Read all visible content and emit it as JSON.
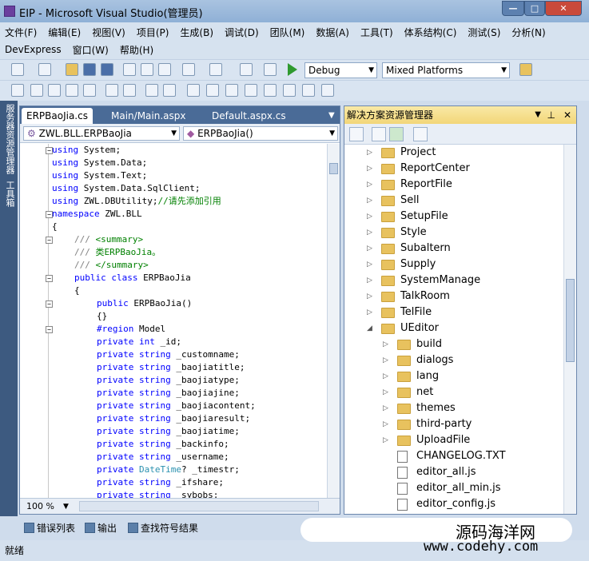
{
  "window": {
    "title": "EIP - Microsoft Visual Studio(管理员)",
    "min": "—",
    "max": "□",
    "close": "✕"
  },
  "menu": {
    "row1": [
      "文件(F)",
      "编辑(E)",
      "视图(V)",
      "项目(P)",
      "生成(B)",
      "调试(D)",
      "团队(M)",
      "数据(A)",
      "工具(T)",
      "体系结构(C)",
      "测试(S)",
      "分析(N)"
    ],
    "row2": [
      "DevExpress",
      "窗口(W)",
      "帮助(H)"
    ]
  },
  "toolbar": {
    "config": "Debug",
    "platform": "Mixed Platforms",
    "start_icon": "play-icon"
  },
  "leftstrip": {
    "server_explorer": "服务器资源管理器",
    "toolbox": "工具箱"
  },
  "editor": {
    "tabs": [
      "ERPBaoJia.cs",
      "Main/Main.aspx",
      "Default.aspx.cs"
    ],
    "nav_type": "ZWL.BLL.ERPBaoJia",
    "nav_member": "ERPBaoJia()",
    "zoom": "100 %",
    "lines": [
      {
        "c": "using System;",
        "i": 0
      },
      {
        "c": "using System.Data;",
        "i": 0
      },
      {
        "c": "using System.Text;",
        "i": 0
      },
      {
        "c": "using System.Data.SqlClient;",
        "i": 0
      },
      {
        "c": "using ZWL.DBUtility;//请先添加引用",
        "i": 0
      },
      {
        "c": "namespace ZWL.BLL",
        "i": 0
      },
      {
        "c": "{",
        "i": 0
      },
      {
        "c": "/// <summary>",
        "i": 4
      },
      {
        "c": "/// 类ERPBaoJia。",
        "i": 4
      },
      {
        "c": "/// </summary>",
        "i": 4
      },
      {
        "c": "public class ERPBaoJia",
        "i": 4
      },
      {
        "c": "{",
        "i": 4
      },
      {
        "c": "public ERPBaoJia()",
        "i": 8
      },
      {
        "c": "{}",
        "i": 8
      },
      {
        "c": "#region Model",
        "i": 8
      },
      {
        "c": "private int _id;",
        "i": 8
      },
      {
        "c": "private string _customname;",
        "i": 8
      },
      {
        "c": "private string _baojiatitle;",
        "i": 8
      },
      {
        "c": "private string _baojiatype;",
        "i": 8
      },
      {
        "c": "private string _baojiajine;",
        "i": 8
      },
      {
        "c": "private string _baojiacontent;",
        "i": 8
      },
      {
        "c": "private string _baojiaresult;",
        "i": 8
      },
      {
        "c": "private string _baojiatime;",
        "i": 8
      },
      {
        "c": "private string _backinfo;",
        "i": 8
      },
      {
        "c": "private string _username;",
        "i": 8
      },
      {
        "c": "private DateTime? _timestr;",
        "i": 8
      },
      {
        "c": "private string _ifshare;",
        "i": 8
      },
      {
        "c": "private string _sybobs;",
        "i": 8
      }
    ]
  },
  "solution": {
    "title": "解决方案资源管理器",
    "items": [
      {
        "label": "Project",
        "d": 0,
        "t": "folder",
        "e": "▷"
      },
      {
        "label": "ReportCenter",
        "d": 0,
        "t": "folder",
        "e": "▷"
      },
      {
        "label": "ReportFile",
        "d": 0,
        "t": "folder",
        "e": "▷"
      },
      {
        "label": "Sell",
        "d": 0,
        "t": "folder",
        "e": "▷"
      },
      {
        "label": "SetupFile",
        "d": 0,
        "t": "folder",
        "e": "▷"
      },
      {
        "label": "Style",
        "d": 0,
        "t": "folder",
        "e": "▷"
      },
      {
        "label": "Subaltern",
        "d": 0,
        "t": "folder",
        "e": "▷"
      },
      {
        "label": "Supply",
        "d": 0,
        "t": "folder",
        "e": "▷"
      },
      {
        "label": "SystemManage",
        "d": 0,
        "t": "folder",
        "e": "▷"
      },
      {
        "label": "TalkRoom",
        "d": 0,
        "t": "folder",
        "e": "▷"
      },
      {
        "label": "TelFile",
        "d": 0,
        "t": "folder",
        "e": "▷"
      },
      {
        "label": "UEditor",
        "d": 0,
        "t": "folder",
        "e": "◢"
      },
      {
        "label": "build",
        "d": 1,
        "t": "folder",
        "e": "▷"
      },
      {
        "label": "dialogs",
        "d": 1,
        "t": "folder",
        "e": "▷"
      },
      {
        "label": "lang",
        "d": 1,
        "t": "folder",
        "e": "▷"
      },
      {
        "label": "net",
        "d": 1,
        "t": "folder",
        "e": "▷"
      },
      {
        "label": "themes",
        "d": 1,
        "t": "folder",
        "e": "▷"
      },
      {
        "label": "third-party",
        "d": 1,
        "t": "folder",
        "e": "▷"
      },
      {
        "label": "UploadFile",
        "d": 1,
        "t": "folder",
        "e": "▷"
      },
      {
        "label": "CHANGELOG.TXT",
        "d": 1,
        "t": "file",
        "e": ""
      },
      {
        "label": "editor_all.js",
        "d": 1,
        "t": "file",
        "e": ""
      },
      {
        "label": "editor_all_min.js",
        "d": 1,
        "t": "file",
        "e": ""
      },
      {
        "label": "editor_config.js",
        "d": 1,
        "t": "file",
        "e": ""
      }
    ]
  },
  "output_tabs": [
    "错误列表",
    "输出",
    "查找符号结果"
  ],
  "status": "就绪",
  "watermark": {
    "line1": "源码海洋网",
    "line2": "www.codehy.com"
  }
}
